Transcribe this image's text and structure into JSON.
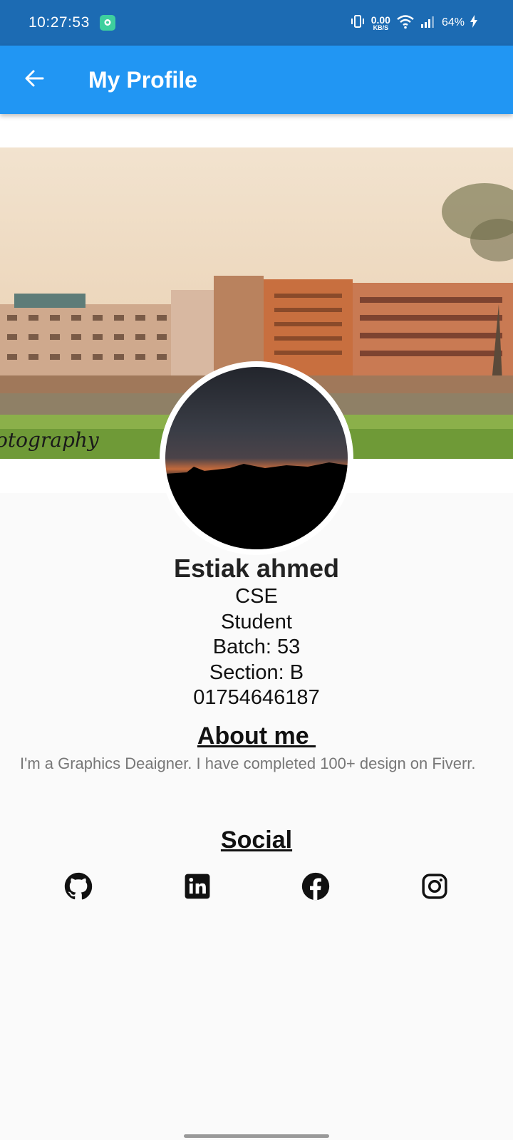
{
  "status_bar": {
    "time": "10:27:53",
    "network_speed_value": "0.00",
    "network_speed_unit": "KB/S",
    "battery": "64%"
  },
  "appbar": {
    "title": "My Profile",
    "back_icon": "arrow-back-icon"
  },
  "profile": {
    "name": "Estiak ahmed",
    "department": "CSE",
    "role": "Student",
    "batch": "Batch: 53",
    "section": "Section: B",
    "phone": "01754646187"
  },
  "about": {
    "heading": "About me ",
    "text": "I'm a Graphics Deaigner. I have completed 100+ design on Fiverr."
  },
  "social": {
    "heading": "Social",
    "icons": [
      "github-icon",
      "linkedin-icon",
      "facebook-icon",
      "instagram-icon"
    ]
  },
  "colors": {
    "status_bar": "#1c6bb3",
    "appbar": "#2196f3",
    "background": "#fafafa"
  }
}
